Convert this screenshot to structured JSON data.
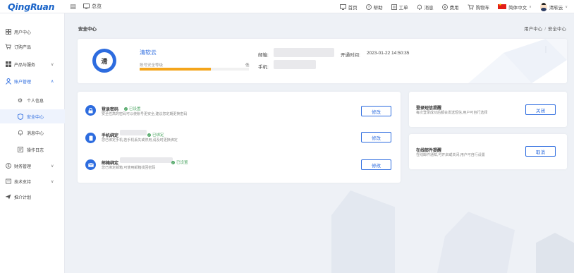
{
  "brand": {
    "logo": "QingRuan",
    "accent": "#2d6cdf"
  },
  "topbar": {
    "menu_icon": "menu-icon",
    "console_label": "总览",
    "nav": [
      {
        "icon": "monitor-icon",
        "label": "首页"
      },
      {
        "icon": "help-icon",
        "label": "帮助"
      },
      {
        "icon": "ticket-icon",
        "label": "工单"
      },
      {
        "icon": "bell-icon",
        "label": "消息"
      },
      {
        "icon": "yen-icon",
        "label": "费用"
      },
      {
        "icon": "cart-icon",
        "label": "购物车"
      }
    ],
    "language": "简体中文",
    "user": "清软云"
  },
  "sidebar": {
    "items": [
      {
        "icon": "grid-icon",
        "label": "用户中心"
      },
      {
        "icon": "cart-icon",
        "label": "订购产品"
      },
      {
        "icon": "apps-icon",
        "label": "产品与服务"
      },
      {
        "icon": "user-icon",
        "label": "账户管理"
      },
      {
        "icon": "gear-icon",
        "label": "个人信息"
      },
      {
        "icon": "shield-icon",
        "label": "安全中心"
      },
      {
        "icon": "bell-icon",
        "label": "消息中心"
      },
      {
        "icon": "log-icon",
        "label": "操作日志"
      },
      {
        "icon": "money-icon",
        "label": "财务管理"
      },
      {
        "icon": "support-icon",
        "label": "技术支持"
      },
      {
        "icon": "send-icon",
        "label": "推介计划"
      }
    ]
  },
  "page": {
    "title": "安全中心",
    "breadcrumb": [
      "用户中心",
      "安全中心"
    ]
  },
  "profile": {
    "avatar_char": "清",
    "username": "清软云",
    "level_label": "账号安全等级",
    "level_value": "低",
    "level_percent": 65,
    "email_label": "邮箱:",
    "phone_label": "手机:",
    "open_time_label": "开通时间:",
    "open_time": "2023-01-22 14:50:35"
  },
  "security_items": [
    {
      "icon": "lock-icon",
      "title": "登录密码",
      "status": "已设置",
      "desc": "安全性高的密码可以使账号更安全,建议您定期更换密码",
      "button": "修改"
    },
    {
      "icon": "phone-icon",
      "title": "手机绑定",
      "status": "已绑定",
      "desc": "您已绑定手机,若手机丢失或停用,请及时更换绑定",
      "button": "修改"
    },
    {
      "icon": "mail-icon",
      "title": "邮箱绑定",
      "status": "已设置",
      "desc": "您已绑定邮箱,可使用邮箱找回密码",
      "button": "修改"
    }
  ],
  "side_items": [
    {
      "title": "登录短信提醒",
      "desc": "每次登录成功后都会发送短信,用户可自行选择",
      "button": "关闭"
    },
    {
      "title": "在线邮件提醒",
      "desc": "在线邮件通知,可开启或关闭,用户可自行设置",
      "button": "取消"
    }
  ]
}
